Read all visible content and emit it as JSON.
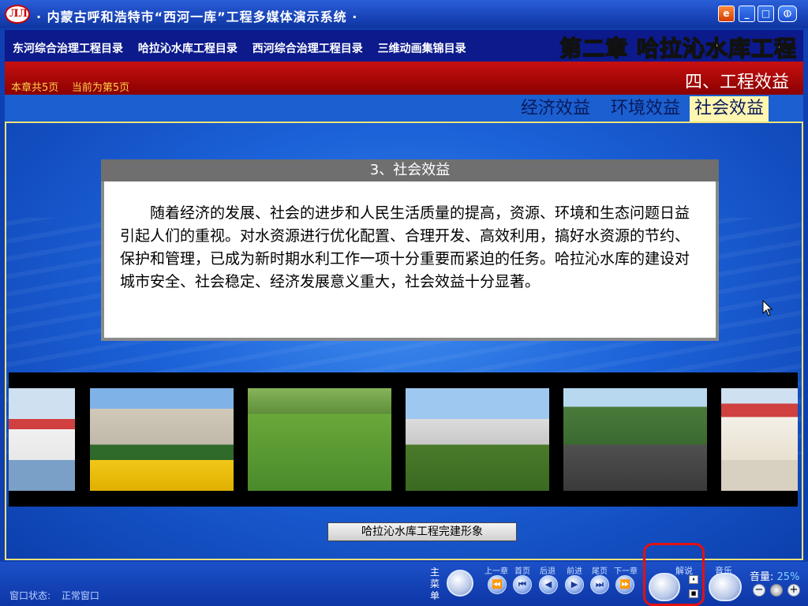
{
  "window": {
    "logo_text": "ЛЛ",
    "title": "· 内蒙古呼和浩特市“西河一库”工程多媒体演示系统 ·",
    "buttons": {
      "ie": "e",
      "min": "_",
      "max": "□",
      "close": "⏼"
    }
  },
  "nav": {
    "links": [
      "东河综合治理工程目录",
      "哈拉沁水库工程目录",
      "西河综合治理工程目录",
      "三维动画集锦目录"
    ],
    "chapter": "第二章 哈拉沁水库工程"
  },
  "header": {
    "pages_total": "本章共5页",
    "pages_current": "当前为第5页",
    "section": "四、工程效益"
  },
  "tabs": [
    "经济效益",
    "环境效益",
    "社会效益"
  ],
  "tabs_active": 2,
  "content": {
    "heading": "3、社会效益",
    "body": "随着经济的发展、社会的进步和人民生活质量的提高，资源、环境和生态问题日益引起人们的重视。对水资源进行优化配置、合理开发、高效利用，搞好水资源的节约、保护和管理，已成为新时期水利工作一项十分重要而紧迫的任务。哈拉沁水库的建设对城市安全、社会稳定、经济发展意义重大，社会效益十分显著。"
  },
  "gallery": {
    "caption": "哈拉沁水库工程完建形象",
    "photos": [
      "building-photo",
      "flowers-gate-photo",
      "park-people-photo",
      "statue-photo",
      "road-car-photo",
      "building-photo-2"
    ]
  },
  "bottom": {
    "status_label": "窗口状态:",
    "status_value": "正常窗口",
    "main_menu": "主菜单",
    "nav_labels": [
      "上一章",
      "首页",
      "后退",
      "前进",
      "尾页",
      "下一章"
    ],
    "narration": "解说",
    "music": "音乐",
    "volume_label": "音量:",
    "volume_value": "25%"
  },
  "colors": {
    "accent_yellow": "#f6d35a",
    "header_red": "#c81010",
    "tab_active": "#fff7b0",
    "highlight_ring": "#e51010"
  }
}
